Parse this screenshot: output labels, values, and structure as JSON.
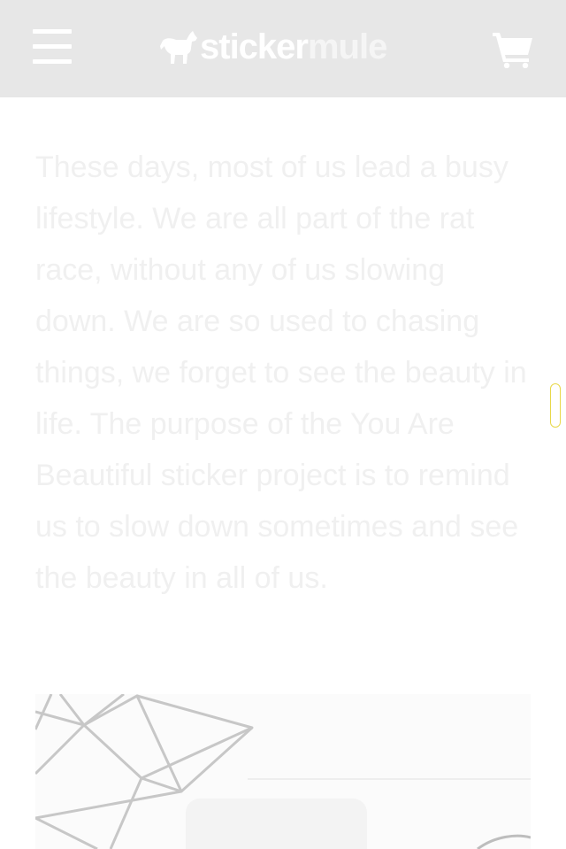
{
  "header": {
    "menu_icon": "hamburger-menu-icon",
    "logo": {
      "icon": "mule-icon",
      "word_sticker": "sticker",
      "word_mule": "mule"
    },
    "cart_icon": "shopping-cart-icon",
    "background": "#e7e7e7"
  },
  "main": {
    "paragraph": "These days, most of us lead a busy lifestyle. We are all part of the rat race, without any of us slowing down. We are so used to chasing things, we forget to see the beauty in life. The purpose of the You Are Beautiful sticker project is to remind us to slow down sometimes and see the beauty in all of us."
  },
  "colors": {
    "text": "#f0f0f0",
    "scroll_handle_border": "#e8d84a"
  }
}
